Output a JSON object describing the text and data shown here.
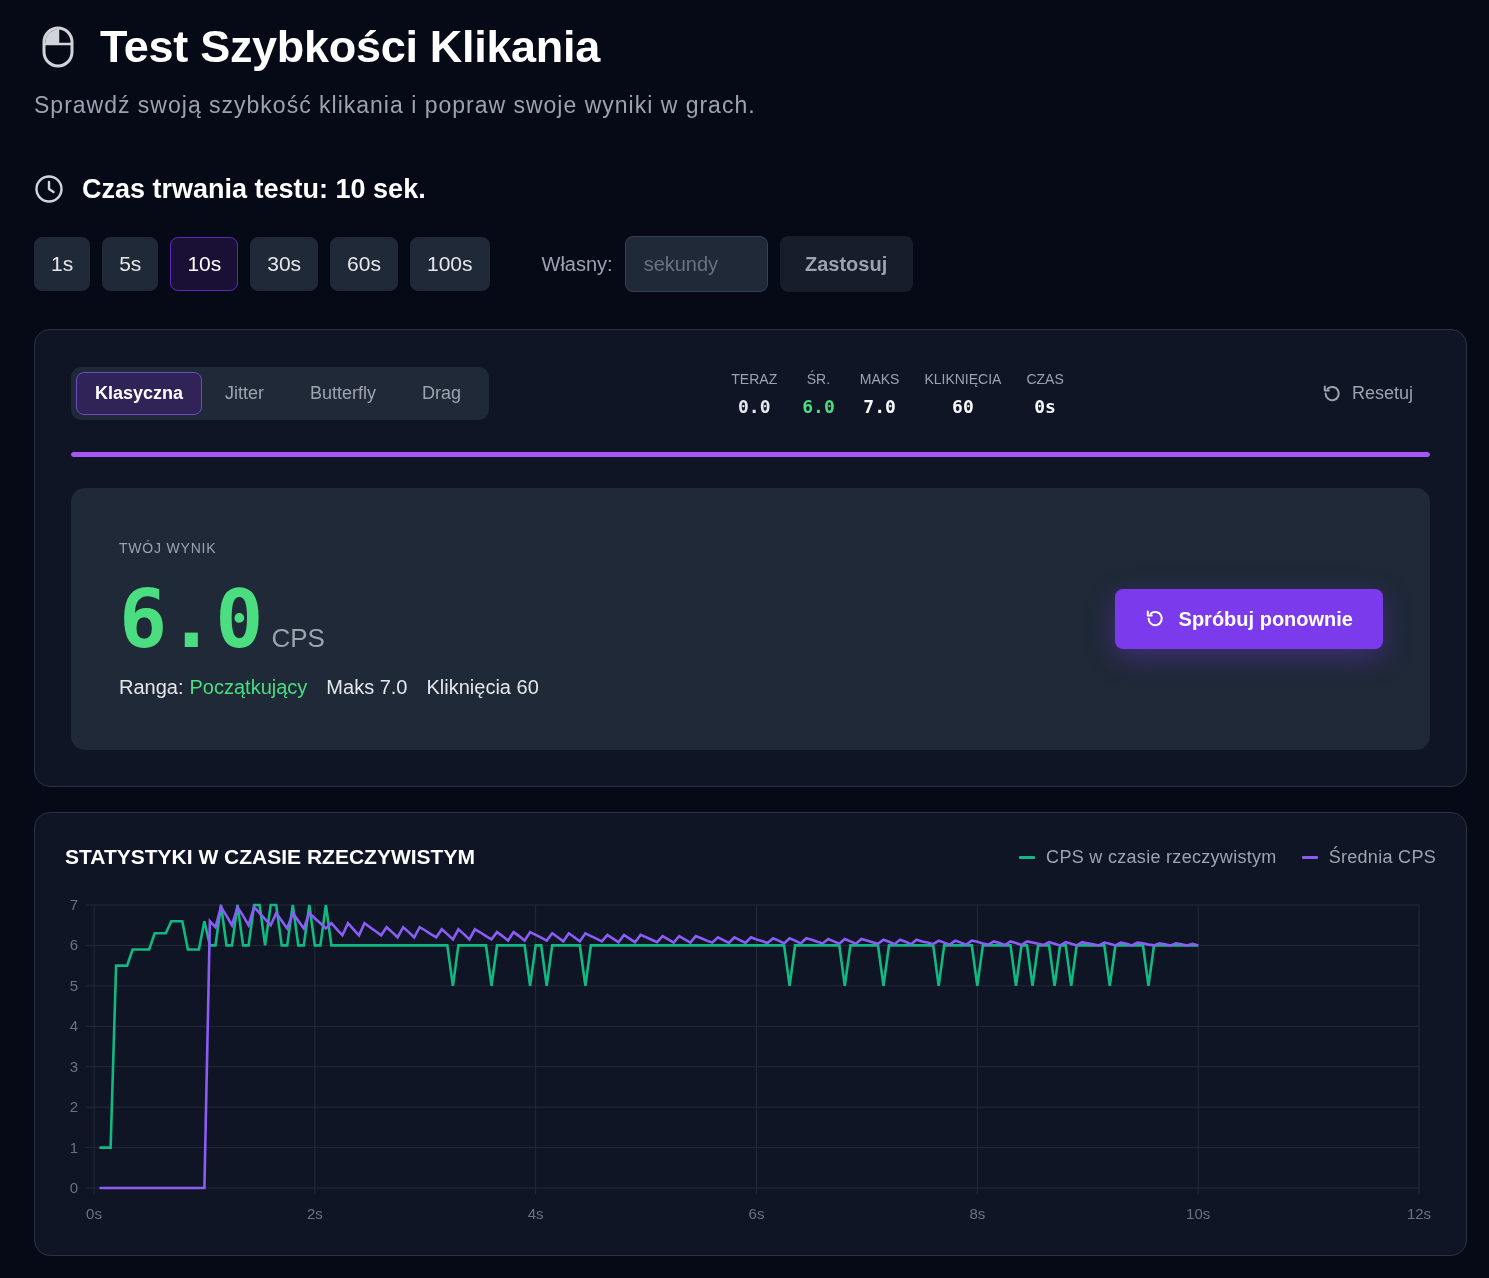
{
  "header": {
    "title": "Test Szybkości Klikania",
    "subtitle": "Sprawdź swoją szybkość klikania i popraw swoje wyniki w grach."
  },
  "duration": {
    "heading": "Czas trwania testu: 10 sek.",
    "presets": [
      {
        "label": "1s",
        "selected": false
      },
      {
        "label": "5s",
        "selected": false
      },
      {
        "label": "10s",
        "selected": true
      },
      {
        "label": "30s",
        "selected": false
      },
      {
        "label": "60s",
        "selected": false
      },
      {
        "label": "100s",
        "selected": false
      }
    ],
    "custom_label": "Własny:",
    "custom_input": {
      "placeholder": "sekundy"
    },
    "apply_button": "Zastosuj"
  },
  "test_panel": {
    "modes": [
      {
        "label": "Klasyczna",
        "selected": true
      },
      {
        "label": "Jitter",
        "selected": false
      },
      {
        "label": "Butterfly",
        "selected": false
      },
      {
        "label": "Drag",
        "selected": false
      }
    ],
    "stats": [
      {
        "label": "TERAZ",
        "value": "0.0",
        "color": "#e5e7eb"
      },
      {
        "label": "ŚR.",
        "value": "6.0",
        "color": "#4ade80"
      },
      {
        "label": "MAKS",
        "value": "7.0",
        "color": "#f9fafb"
      },
      {
        "label": "KLIKNIĘCIA",
        "value": "60",
        "color": "#f9fafb"
      },
      {
        "label": "CZAS",
        "value": "0s",
        "color": "#f9fafb"
      }
    ],
    "reset_button": "Resetuj",
    "progress": {
      "level": 1
    },
    "result": {
      "heading": "TWÓJ WYNIK",
      "score": "6.0",
      "unit": "CPS",
      "rank_label": "Ranga:",
      "rank": "Początkujący",
      "max": "Maks 7.0",
      "clicks": "Kliknięcia 60",
      "retry_button": "Spróbuj ponownie"
    }
  },
  "stats_panel": {
    "chart_data": {
      "type": "line",
      "title": "STATYSTYKI W CZASIE RZECZYWISTYM",
      "grid": true,
      "x": [
        0.05,
        0.1,
        0.15,
        0.2,
        0.25,
        0.3,
        0.35,
        0.4,
        0.45,
        0.5,
        0.55,
        0.6,
        0.65,
        0.7,
        0.75,
        0.8,
        0.85,
        0.9,
        0.95,
        1,
        1.05,
        1.1,
        1.15,
        1.2,
        1.25,
        1.3,
        1.35,
        1.4,
        1.45,
        1.5,
        1.55,
        1.6,
        1.65,
        1.7,
        1.75,
        1.8,
        1.85,
        1.9,
        1.95,
        2,
        2.05,
        2.1,
        2.15,
        2.2,
        2.25,
        2.3,
        2.35,
        2.4,
        2.45,
        2.5,
        2.55,
        2.6,
        2.65,
        2.7,
        2.75,
        2.8,
        2.85,
        2.9,
        2.95,
        3,
        3.05,
        3.1,
        3.15,
        3.2,
        3.25,
        3.3,
        3.35,
        3.4,
        3.45,
        3.5,
        3.55,
        3.6,
        3.65,
        3.7,
        3.75,
        3.8,
        3.85,
        3.9,
        3.95,
        4,
        4.05,
        4.1,
        4.15,
        4.2,
        4.25,
        4.3,
        4.35,
        4.4,
        4.45,
        4.5,
        4.55,
        4.6,
        4.65,
        4.7,
        4.75,
        4.8,
        4.85,
        4.9,
        4.95,
        5,
        5.05,
        5.1,
        5.15,
        5.2,
        5.25,
        5.3,
        5.35,
        5.4,
        5.45,
        5.5,
        5.55,
        5.6,
        5.65,
        5.7,
        5.75,
        5.8,
        5.85,
        5.9,
        5.95,
        6,
        6.05,
        6.1,
        6.15,
        6.2,
        6.25,
        6.3,
        6.35,
        6.4,
        6.45,
        6.5,
        6.55,
        6.6,
        6.65,
        6.7,
        6.75,
        6.8,
        6.85,
        6.9,
        6.95,
        7,
        7.05,
        7.1,
        7.15,
        7.2,
        7.25,
        7.3,
        7.35,
        7.4,
        7.45,
        7.5,
        7.55,
        7.6,
        7.65,
        7.7,
        7.75,
        7.8,
        7.85,
        7.9,
        7.95,
        8,
        8.05,
        8.1,
        8.15,
        8.2,
        8.25,
        8.3,
        8.35,
        8.4,
        8.45,
        8.5,
        8.55,
        8.6,
        8.65,
        8.7,
        8.75,
        8.8,
        8.85,
        8.9,
        8.95,
        9,
        9.05,
        9.1,
        9.15,
        9.2,
        9.25,
        9.3,
        9.35,
        9.4,
        9.45,
        9.5,
        9.55,
        9.6,
        9.65,
        9.7,
        9.75,
        9.8,
        9.85,
        9.9,
        9.95,
        10
      ],
      "series": [
        {
          "name": "CPS w czasie rzeczywistym",
          "color": "#10b981",
          "values": [
            1,
            1,
            1,
            5.5,
            5.5,
            5.5,
            5.9,
            5.9,
            5.9,
            5.9,
            6.3,
            6.3,
            6.3,
            6.6,
            6.6,
            6.6,
            5.9,
            5.9,
            5.9,
            6.6,
            6,
            6,
            7,
            6,
            6,
            7,
            6,
            6,
            7,
            7,
            6,
            7,
            7,
            6,
            6,
            7,
            6,
            6,
            7,
            6,
            6,
            7,
            6,
            6,
            6,
            6,
            6,
            6,
            6,
            6,
            6,
            6,
            6,
            6,
            6,
            6,
            6,
            6,
            6,
            6,
            6,
            6,
            6,
            6,
            5,
            6,
            6,
            6,
            6,
            6,
            6,
            5,
            6,
            6,
            6,
            6,
            6,
            6,
            5,
            6,
            6,
            5,
            6,
            6,
            6,
            6,
            6,
            6,
            5,
            6,
            6,
            6,
            6,
            6,
            6,
            6,
            6,
            6,
            6,
            6,
            6,
            6,
            6,
            6,
            6,
            6,
            6,
            6,
            6,
            6,
            6,
            6,
            6,
            6,
            6,
            6,
            6,
            6,
            6,
            6,
            6,
            6,
            6,
            6,
            6,
            5,
            6,
            6,
            6,
            6,
            6,
            6,
            6,
            6,
            6,
            5,
            6,
            6,
            6,
            6,
            6,
            6,
            5,
            6,
            6,
            6,
            6,
            6,
            6,
            6,
            6,
            6,
            5,
            6,
            6,
            6,
            6,
            6,
            6,
            5,
            6,
            6,
            6,
            6,
            6,
            6,
            5,
            6,
            6,
            5,
            6,
            6,
            6,
            5,
            6,
            6,
            5,
            6,
            6,
            6,
            6,
            6,
            6,
            5,
            6,
            6,
            6,
            6,
            6,
            6,
            5,
            6,
            6,
            6,
            6,
            6,
            6,
            6,
            6,
            6
          ]
        },
        {
          "name": "Średnia CPS",
          "color": "#8b5cf6",
          "values": [
            0,
            0,
            0,
            0,
            0,
            0,
            0,
            0,
            0,
            0,
            0,
            0,
            0,
            0,
            0,
            0,
            0,
            0,
            0,
            0,
            6.6,
            6.45,
            6.95,
            6.73,
            6.5,
            6.95,
            6.73,
            6.5,
            6.95,
            6.8,
            6.65,
            6.5,
            6.8,
            6.61,
            6.42,
            6.8,
            6.61,
            6.42,
            6.8,
            6.67,
            6.55,
            6.42,
            6.55,
            6.4,
            6.25,
            6.55,
            6.4,
            6.25,
            6.55,
            6.45,
            6.35,
            6.25,
            6.45,
            6.33,
            6.2,
            6.45,
            6.33,
            6.2,
            6.45,
            6.37,
            6.28,
            6.2,
            6.4,
            6.28,
            6.15,
            6.4,
            6.28,
            6.15,
            6.4,
            6.32,
            6.23,
            6.15,
            6.33,
            6.23,
            6.12,
            6.33,
            6.23,
            6.12,
            6.33,
            6.26,
            6.19,
            6.12,
            6.3,
            6.2,
            6.1,
            6.3,
            6.2,
            6.1,
            6.3,
            6.23,
            6.17,
            6.1,
            6.26,
            6.17,
            6.08,
            6.26,
            6.17,
            6.08,
            6.26,
            6.2,
            6.14,
            6.08,
            6.23,
            6.15,
            6.07,
            6.23,
            6.15,
            6.07,
            6.23,
            6.18,
            6.12,
            6.07,
            6.2,
            6.13,
            6.06,
            6.2,
            6.13,
            6.06,
            6.2,
            6.15,
            6.11,
            6.06,
            6.18,
            6.12,
            6.05,
            6.18,
            6.12,
            6.05,
            6.18,
            6.14,
            6.09,
            6.05,
            6.16,
            6.1,
            6.04,
            6.16,
            6.1,
            6.04,
            6.16,
            6.12,
            6.08,
            6.04,
            6.14,
            6.09,
            6.03,
            6.14,
            6.09,
            6.03,
            6.14,
            6.1,
            6.07,
            6.03,
            6.12,
            6.07,
            6.02,
            6.12,
            6.07,
            6.02,
            6.12,
            6.09,
            6.05,
            6.02,
            6.1,
            6.06,
            6.01,
            6.1,
            6.06,
            6.01,
            6.1,
            6.07,
            6.04,
            6.01,
            6.08,
            6.04,
            6,
            6.08,
            6.04,
            6,
            6.08,
            6.05,
            6.03,
            6,
            6.07,
            6.04,
            6,
            6.07,
            6.04,
            6,
            6.07,
            6.05,
            6.02,
            6,
            6.05,
            6.03,
            6,
            6.05,
            6.03,
            6,
            6.04,
            6
          ]
        }
      ],
      "xlim": [
        0,
        12
      ],
      "ylim": [
        0,
        7
      ],
      "xticks": [
        {
          "value": 0,
          "label": "0s"
        },
        {
          "value": 2,
          "label": "2s"
        },
        {
          "value": 4,
          "label": "4s"
        },
        {
          "value": 6,
          "label": "6s"
        },
        {
          "value": 8,
          "label": "8s"
        },
        {
          "value": 10,
          "label": "10s"
        },
        {
          "value": 12,
          "label": "12s"
        }
      ],
      "yticks": [
        0,
        1,
        2,
        3,
        4,
        5,
        6,
        7
      ]
    }
  }
}
